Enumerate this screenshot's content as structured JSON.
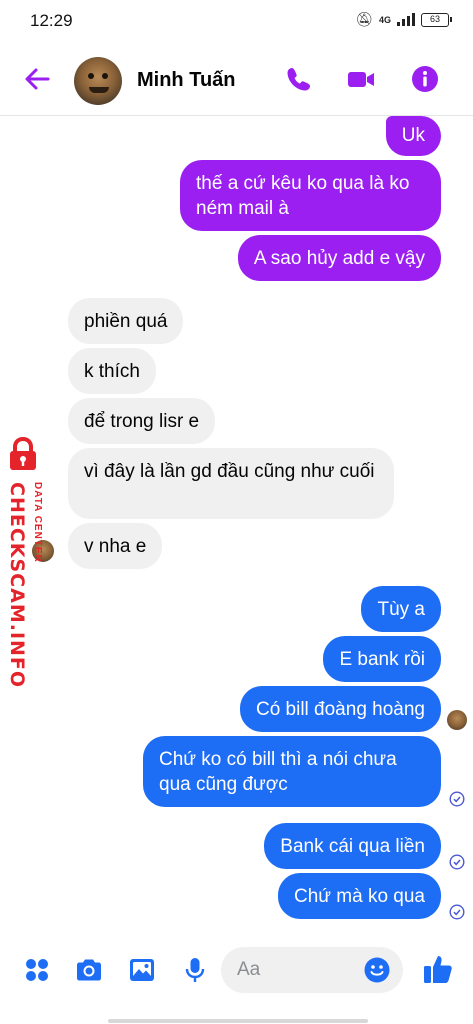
{
  "status_bar": {
    "time": "12:29",
    "network": "4G",
    "battery": "63"
  },
  "header": {
    "contact_name": "Minh Tuấn",
    "icons": [
      "back-arrow-icon",
      "phone-icon",
      "video-camera-icon",
      "info-icon"
    ],
    "accent_color": "#9b1ff0"
  },
  "messages": [
    {
      "text": "Uk",
      "side": "sent",
      "color": "#9b1ff0"
    },
    {
      "text": "thế a cứ kêu ko qua là ko ném mail à",
      "side": "sent",
      "color": "#9b1ff0"
    },
    {
      "text": "A sao hủy add e vậy",
      "side": "sent",
      "color": "#9b1ff0"
    },
    {
      "text": "phiền quá",
      "side": "received"
    },
    {
      "text": "k thích",
      "side": "received"
    },
    {
      "text": "để trong lisr e",
      "side": "received"
    },
    {
      "text": "vì đây là lần gd đầu cũng như cuối",
      "side": "received"
    },
    {
      "text": "v nha e",
      "side": "received"
    },
    {
      "text": "Tùy a",
      "side": "sent",
      "color": "#1e6df5"
    },
    {
      "text": "E bank rồi",
      "side": "sent",
      "color": "#1e6df5"
    },
    {
      "text": "Có bill đoàng hoàng",
      "side": "sent",
      "color": "#1e6df5"
    },
    {
      "text": "Chứ ko có bill thì a nói chưa qua cũng được",
      "side": "sent",
      "color": "#1e6df5"
    },
    {
      "text": "Bank cái qua liền",
      "side": "sent",
      "color": "#1e6df5"
    },
    {
      "text": "Chứ mà ko qua",
      "side": "sent",
      "color": "#1e6df5"
    }
  ],
  "watermark": {
    "main": "CHECKSCAM.INFO",
    "sub": "DATA CENTER",
    "color": "#e5232a"
  },
  "composer": {
    "placeholder": "Aa",
    "icons": [
      "apps-icon",
      "camera-icon",
      "image-icon",
      "microphone-icon",
      "emoji-icon",
      "thumbs-up-icon"
    ],
    "accent_color": "#1e6df5"
  }
}
